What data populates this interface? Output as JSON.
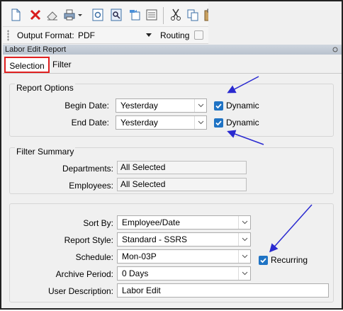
{
  "toolbar": {
    "icons": [
      "new-document-icon",
      "delete-x-icon",
      "eraser-icon",
      "print-icon",
      "preview-icon",
      "search-icon",
      "export-icon",
      "import-icon",
      "cut-icon",
      "copy-icon",
      "paste-icon"
    ]
  },
  "format_bar": {
    "output_format_label": "Output Format:",
    "output_format_value": "PDF",
    "routing_label": "Routing",
    "routing_checked": false
  },
  "report": {
    "title": "Labor Edit Report",
    "tabs": [
      {
        "label": "Selection",
        "active": true
      },
      {
        "label": "Filter",
        "active": false
      }
    ]
  },
  "report_options": {
    "title": "Report Options",
    "begin_date_label": "Begin Date:",
    "begin_date_value": "Yesterday",
    "begin_dynamic_label": "Dynamic",
    "begin_dynamic_checked": true,
    "end_date_label": "End Date:",
    "end_date_value": "Yesterday",
    "end_dynamic_label": "Dynamic",
    "end_dynamic_checked": true
  },
  "filter_summary": {
    "title": "Filter Summary",
    "departments_label": "Departments:",
    "departments_value": "All Selected",
    "employees_label": "Employees:",
    "employees_value": "All Selected"
  },
  "settings": {
    "sort_by_label": "Sort By:",
    "sort_by_value": "Employee/Date",
    "report_style_label": "Report Style:",
    "report_style_value": "Standard - SSRS",
    "schedule_label": "Schedule:",
    "schedule_value": "Mon-03P",
    "recurring_label": "Recurring",
    "recurring_checked": true,
    "archive_period_label": "Archive Period:",
    "archive_period_value": "0 Days",
    "user_description_label": "User Description:",
    "user_description_value": "Labor Edit"
  },
  "colors": {
    "accent": "#1f73c4",
    "highlight_border": "#e02020",
    "annotation_arrow": "#2a2ad0"
  }
}
